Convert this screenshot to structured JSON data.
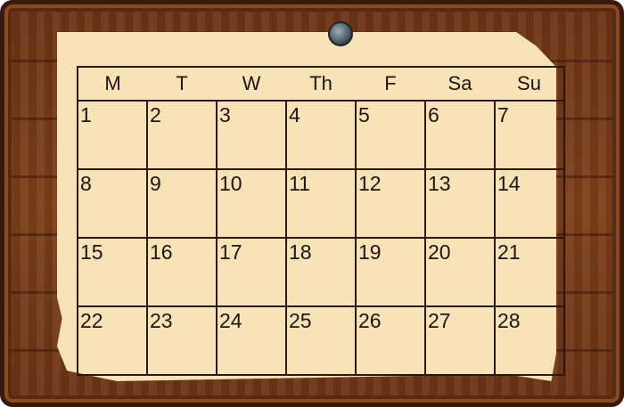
{
  "calendar": {
    "weekdays": [
      "M",
      "T",
      "W",
      "Th",
      "F",
      "Sa",
      "Su"
    ],
    "weeks": [
      [
        "1",
        "2",
        "3",
        "4",
        "5",
        "6",
        "7"
      ],
      [
        "8",
        "9",
        "10",
        "11",
        "12",
        "13",
        "14"
      ],
      [
        "15",
        "16",
        "17",
        "18",
        "19",
        "20",
        "21"
      ],
      [
        "22",
        "23",
        "24",
        "25",
        "26",
        "27",
        "28"
      ]
    ]
  },
  "colors": {
    "board_wood": "#7c401c",
    "board_border": "#3a180a",
    "paper": "#f7e3b5",
    "grid_line": "#2a1a0e",
    "pin": "#5d6f76"
  },
  "icons": {
    "pin": "pushpin-icon"
  }
}
